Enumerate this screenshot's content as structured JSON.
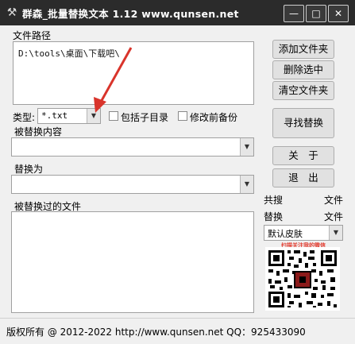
{
  "window": {
    "title": "群森_批量替换文本  1.12   www.qunsen.net",
    "buttons": {
      "minimize": "—",
      "maximize": "□",
      "close": "✕"
    }
  },
  "file_path": {
    "label": "文件路径",
    "value": "D:\\tools\\桌面\\下载吧\\"
  },
  "type": {
    "label": "类型:",
    "value": "*.txt",
    "include_subdirs_label": "包括子目录",
    "backup_label": "修改前备份"
  },
  "search": {
    "label": "被替换内容",
    "value": ""
  },
  "replace": {
    "label": "替换为",
    "value": ""
  },
  "replaced_files": {
    "label": "被替换过的文件"
  },
  "sidebar": {
    "add_folder": "添加文件夹",
    "delete_selected": "删除选中",
    "clear_folders": "清空文件夹",
    "find_replace": "寻找替换",
    "about": "关　于",
    "exit": "退　出",
    "stat1_left": "共搜",
    "stat1_right": "文件",
    "stat2_left": "替换",
    "stat2_right": "文件",
    "skin_value": "默认皮肤",
    "qr_caption": "扫描关注我的微信"
  },
  "statusbar": {
    "text": "版权所有 @ 2012-2022   http://www.qunsen.net   QQ：925433090"
  },
  "colors": {
    "titlebar": "#2b2b2b",
    "arrow": "#d9342b",
    "qr_caption": "#e23b2e"
  },
  "icons": {
    "app": "tools-icon",
    "dropdown": "chevron-down-icon"
  }
}
